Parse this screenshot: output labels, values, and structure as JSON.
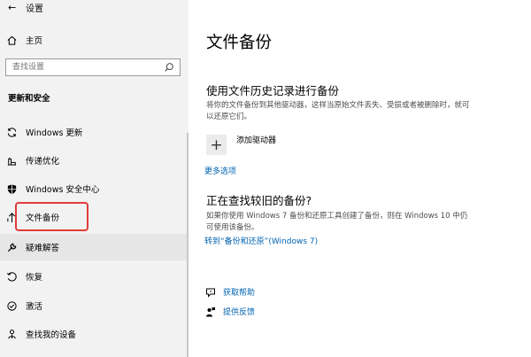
{
  "window": {
    "title": "设置"
  },
  "sidebar": {
    "home_label": "主页",
    "search_placeholder": "查找设置",
    "section_title": "更新和安全",
    "items": [
      {
        "label": "Windows 更新",
        "icon": "sync-icon"
      },
      {
        "label": "传递优化",
        "icon": "delivery-optimization-icon"
      },
      {
        "label": "Windows 安全中心",
        "icon": "shield-icon"
      },
      {
        "label": "文件备份",
        "icon": "backup-arrow-icon",
        "selected": true
      },
      {
        "label": "疑难解答",
        "icon": "wrench-icon"
      },
      {
        "label": "恢复",
        "icon": "recovery-icon"
      },
      {
        "label": "激活",
        "icon": "activation-icon"
      },
      {
        "label": "查找我的设备",
        "icon": "person-location-icon"
      }
    ]
  },
  "main": {
    "title": "文件备份",
    "history": {
      "heading": "使用文件历史记录进行备份",
      "desc": "将你的文件备份到其他驱动器，这样当原始文件丢失、受损或者被删除时，就可以还原它们。",
      "add_drive": "添加驱动器",
      "more_options": "更多选项"
    },
    "older": {
      "heading": "正在查找较旧的备份?",
      "desc": "如果你使用 Windows 7 备份和还原工具创建了备份，则在 Windows 10 中仍可使用该备份。",
      "link": "转到“备份和还原”(Windows 7)"
    },
    "help": {
      "get_help": "获取帮助",
      "feedback": "提供反馈"
    }
  },
  "colors": {
    "accent": "#0063b1",
    "highlight_box": "#e23b3b",
    "sidebar_bg": "#f2f2f2"
  }
}
